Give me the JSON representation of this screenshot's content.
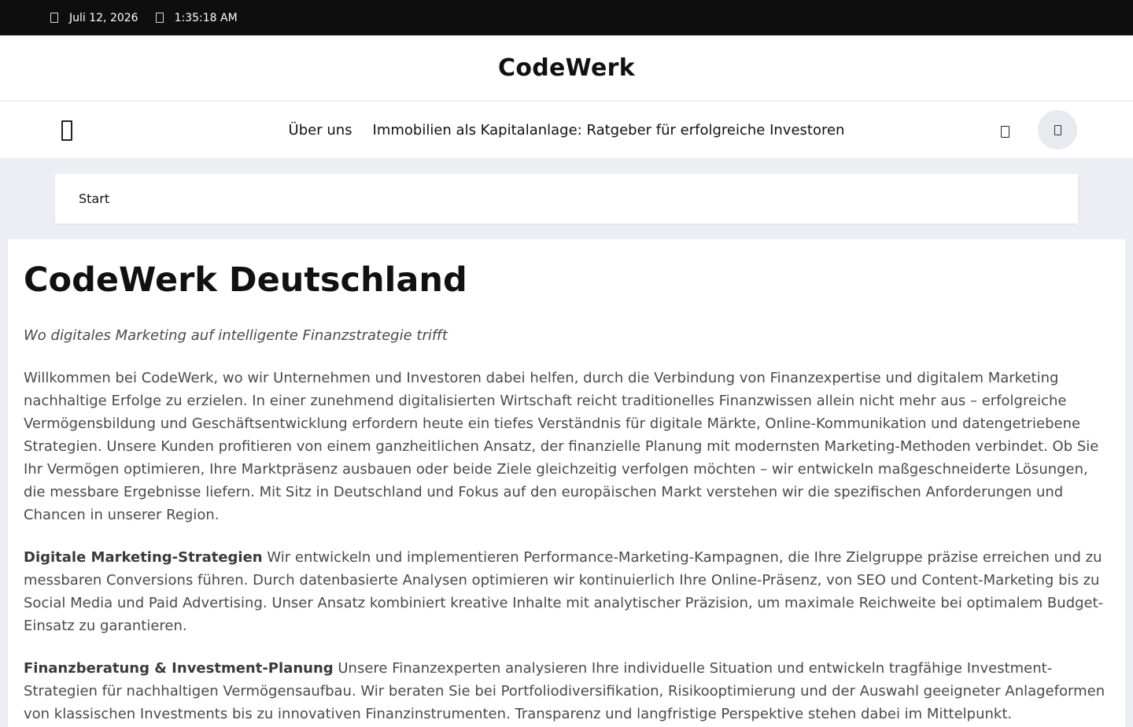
{
  "topbar": {
    "date": "Juli 12, 2026",
    "time": "1:35:18 AM",
    "date_icon": "calendar-icon",
    "time_icon": "clock-icon"
  },
  "brand": {
    "title": "CodeWerk"
  },
  "nav": {
    "items": [
      {
        "label": "Über uns"
      },
      {
        "label": "Immobilien als Kapitalanlage: Ratgeber für erfolgreiche Investoren"
      }
    ],
    "menu_icon": "menu-icon",
    "search_icon": "search-icon",
    "toggle_icon": "theme-toggle-icon"
  },
  "breadcrumb": {
    "label": "Start"
  },
  "article": {
    "title": "CodeWerk Deutschland",
    "tagline": "Wo digitales Marketing auf intelligente Finanzstrategie trifft",
    "intro": "Willkommen bei CodeWerk, wo wir Unternehmen und Investoren dabei helfen, durch die Verbindung von Finanzexpertise und digitalem Marketing nachhaltige Erfolge zu erzielen. In einer zunehmend digitalisierten Wirtschaft reicht traditionelles Finanzwissen allein nicht mehr aus – erfolgreiche Vermögensbildung und Geschäftsentwicklung erfordern heute ein tiefes Verständnis für digitale Märkte, Online-Kommunikation und datengetriebene Strategien. Unsere Kunden profitieren von einem ganzheitlichen Ansatz, der finanzielle Planung mit modernsten Marketing-Methoden verbindet. Ob Sie Ihr Vermögen optimieren, Ihre Marktpräsenz ausbauen oder beide Ziele gleichzeitig verfolgen möchten – wir entwickeln maßgeschneiderte Lösungen, die messbare Ergebnisse liefern. Mit Sitz in Deutschland und Fokus auf den europäischen Markt verstehen wir die spezifischen Anforderungen und Chancen in unserer Region.",
    "sections": [
      {
        "heading": "Digitale Marketing-Strategien",
        "text": " Wir entwickeln und implementieren Performance-Marketing-Kampagnen, die Ihre Zielgruppe präzise erreichen und zu messbaren Conversions führen. Durch datenbasierte Analysen optimieren wir kontinuierlich Ihre Online-Präsenz, von SEO und Content-Marketing bis zu Social Media und Paid Advertising. Unser Ansatz kombiniert kreative Inhalte mit analytischer Präzision, um maximale Reichweite bei optimalem Budget-Einsatz zu garantieren."
      },
      {
        "heading": "Finanzberatung & Investment-Planung",
        "text": " Unsere Finanzexperten analysieren Ihre individuelle Situation und entwickeln tragfähige Investment-Strategien für nachhaltigen Vermögensaufbau. Wir beraten Sie bei Portfoliodiversifikation, Risikooptimierung und der Auswahl geeigneter Anlageformen von klassischen Investments bis zu innovativen Finanzinstrumenten. Transparenz und langfristige Perspektive stehen dabei im Mittelpunkt."
      }
    ]
  }
}
